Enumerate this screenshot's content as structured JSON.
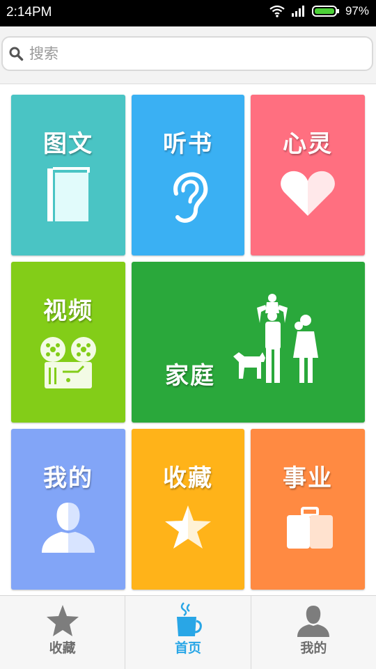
{
  "status_bar": {
    "time": "2:14PM",
    "battery": "97%"
  },
  "search": {
    "placeholder": "搜索"
  },
  "tiles": {
    "tuwen": {
      "label": "图文",
      "color": "#4ac4c4"
    },
    "tingshu": {
      "label": "听书",
      "color": "#3ab0f3"
    },
    "xinling": {
      "label": "心灵",
      "color": "#ff6f80"
    },
    "shipin": {
      "label": "视频",
      "color": "#83cd18"
    },
    "jiating": {
      "label": "家庭",
      "color": "#2aa83b"
    },
    "wode": {
      "label": "我的",
      "color": "#82a5f7"
    },
    "shoucang": {
      "label": "收藏",
      "color": "#ffb319"
    },
    "shiye": {
      "label": "事业",
      "color": "#ff8a42"
    }
  },
  "bottom_nav": [
    {
      "label": "收藏",
      "icon": "star-icon",
      "active": false
    },
    {
      "label": "首页",
      "icon": "cup-icon",
      "active": true
    },
    {
      "label": "我的",
      "icon": "person-icon",
      "active": false
    }
  ]
}
